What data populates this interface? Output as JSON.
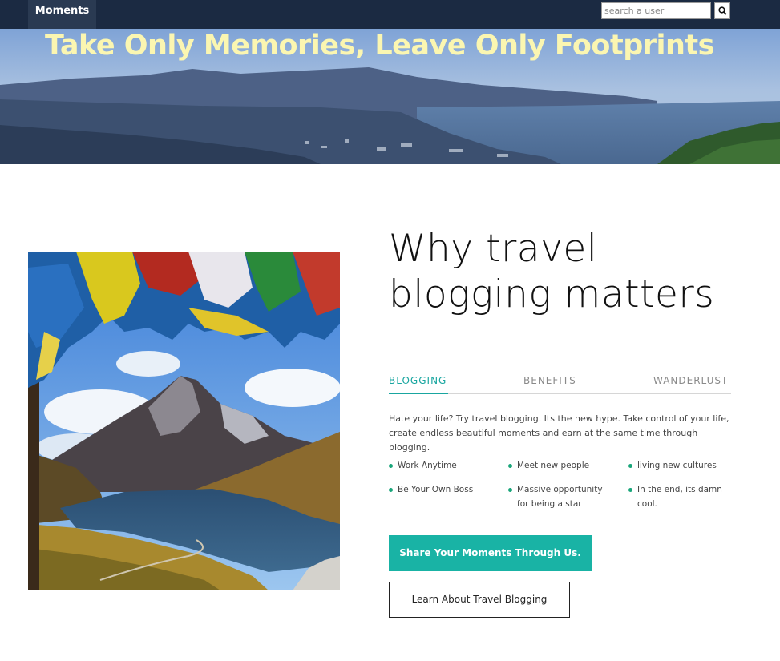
{
  "nav": {
    "brand": "Moments",
    "search_placeholder": "search a user",
    "search_icon": "search-icon"
  },
  "hero": {
    "title": "Take Only Memories, Leave Only Footprints"
  },
  "section": {
    "headline": "Why travel blogging matters",
    "tabs": [
      {
        "label": "BLOGGING",
        "active": true
      },
      {
        "label": "BENEFITS",
        "active": false
      },
      {
        "label": "WANDERLUST",
        "active": false
      }
    ],
    "intro": "Hate your life? Try travel blogging. Its the new hype. Take control of your life, create endless beautiful moments and earn at the same time through blogging.",
    "features": [
      "Work Anytime",
      "Meet new people",
      "living new cultures",
      "Be Your Own Boss",
      "Massive opportunity for being a star",
      "In the end, its damn cool."
    ],
    "primary_button": "Share Your Moments Through Us.",
    "secondary_button": "Learn About Travel Blogging"
  },
  "colors": {
    "navbar": "#1b2a42",
    "hero_title": "#fbf6b1",
    "accent": "#19b3a5",
    "tab_active": "#19a6a0"
  }
}
